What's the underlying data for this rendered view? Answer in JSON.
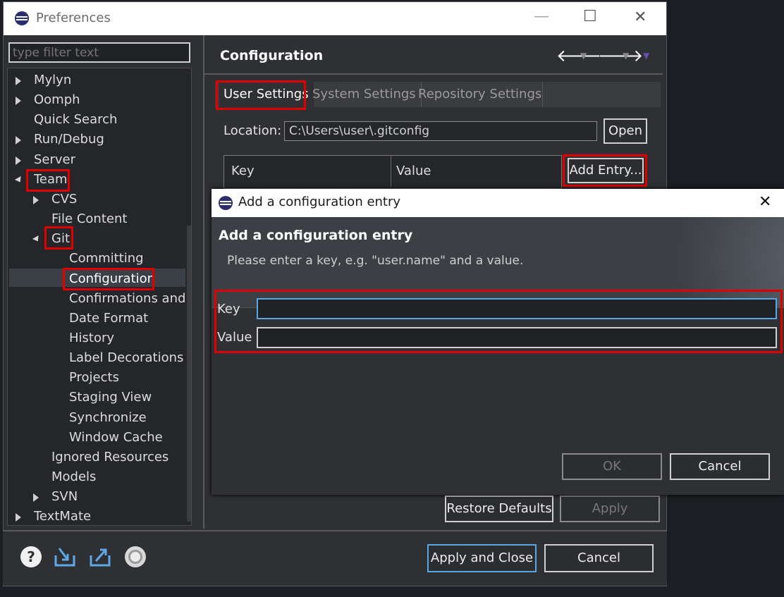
{
  "window": {
    "title": "Preferences",
    "minimize_glyph": "—",
    "maximize_glyph": "☐",
    "close_glyph": "✕"
  },
  "filter": {
    "placeholder": "type filter text"
  },
  "tree": {
    "items": [
      {
        "label": "Mylyn",
        "expander": "collapsed"
      },
      {
        "label": "Oomph",
        "expander": "collapsed"
      },
      {
        "label": "Quick Search",
        "expander": "none"
      },
      {
        "label": "Run/Debug",
        "expander": "collapsed"
      },
      {
        "label": "Server",
        "expander": "collapsed"
      },
      {
        "label": "Team",
        "expander": "expanded"
      },
      {
        "label": "CVS",
        "expander": "collapsed"
      },
      {
        "label": "File Content",
        "expander": "none"
      },
      {
        "label": "Git",
        "expander": "expanded"
      },
      {
        "label": "Committing",
        "expander": "none"
      },
      {
        "label": "Configuration",
        "expander": "none",
        "selected": true
      },
      {
        "label": "Confirmations and W",
        "expander": "none"
      },
      {
        "label": "Date Format",
        "expander": "none"
      },
      {
        "label": "History",
        "expander": "none"
      },
      {
        "label": "Label Decorations",
        "expander": "none"
      },
      {
        "label": "Projects",
        "expander": "none"
      },
      {
        "label": "Staging View",
        "expander": "none"
      },
      {
        "label": "Synchronize",
        "expander": "none"
      },
      {
        "label": "Window Cache",
        "expander": "none"
      },
      {
        "label": "Ignored Resources",
        "expander": "none"
      },
      {
        "label": "Models",
        "expander": "none"
      },
      {
        "label": "SVN",
        "expander": "collapsed"
      },
      {
        "label": "TextMate",
        "expander": "collapsed"
      }
    ]
  },
  "page": {
    "title": "Configuration",
    "tabs": [
      {
        "label": "User Settings",
        "selected": true
      },
      {
        "label": "System Settings",
        "selected": false
      },
      {
        "label": "Repository Settings",
        "selected": false
      }
    ],
    "location_label": "Location:",
    "location_value": "C:\\Users\\user\\.gitconfig",
    "open_button": "Open",
    "add_entry_button": "Add Entry...",
    "table_columns": [
      "Key",
      "Value"
    ],
    "restore_defaults_button": "Restore Defaults",
    "apply_button": "Apply"
  },
  "dialog": {
    "window_title": "Add a configuration entry",
    "close_glyph": "✕",
    "heading": "Add a configuration entry",
    "description": "Please enter a key, e.g. \"user.name\" and a value.",
    "key_label": "Key",
    "key_value": "",
    "value_label": "Value",
    "value_value": "",
    "ok_button": "OK",
    "cancel_button": "Cancel"
  },
  "footer": {
    "icons": [
      "help-icon",
      "import-icon",
      "export-icon",
      "oomph-record-icon"
    ],
    "apply_close_button": "Apply and Close",
    "cancel_button": "Cancel"
  },
  "colors": {
    "highlight": "#e00000",
    "background": "#2f3033",
    "focus": "#58a6e3"
  }
}
